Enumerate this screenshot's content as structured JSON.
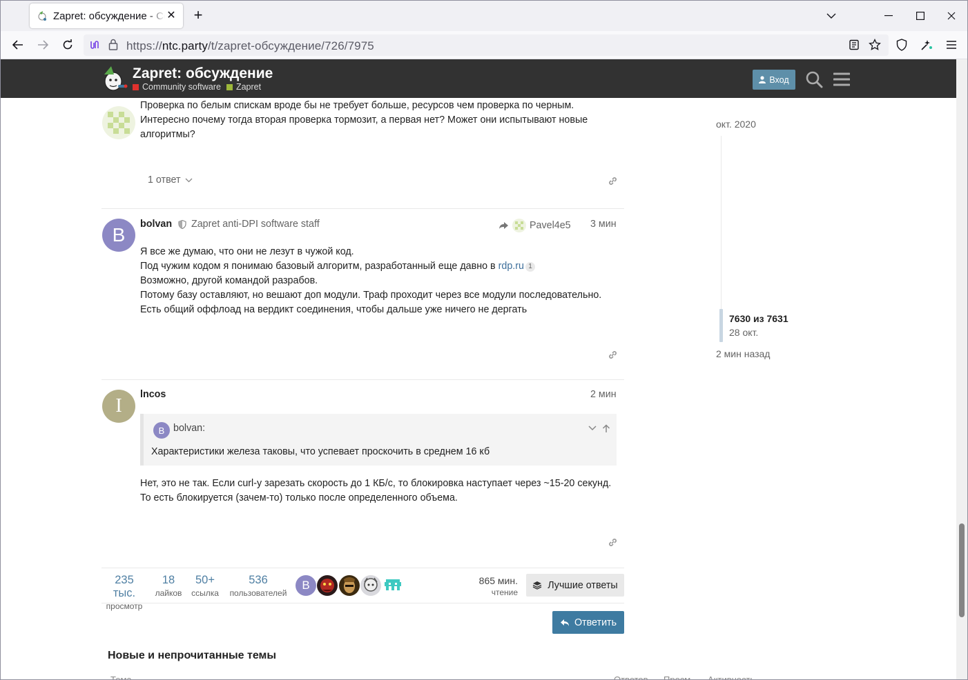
{
  "browser": {
    "tab_title": "Zapret: обсуждение - Community software",
    "url_scheme": "https://",
    "url_host": "ntc.party",
    "url_path": "/t/zapret-обсуждение/726/7975"
  },
  "site": {
    "title": "Zapret: обсуждение",
    "categories": [
      {
        "label": "Community software",
        "color": "#e0312d"
      },
      {
        "label": "Zapret",
        "color": "#9eb83b"
      }
    ],
    "login_label": "Вход"
  },
  "posts": [
    {
      "lines": [
        "Проверка по белым спискам вроде бы не требует больше, ресурсов чем проверка по черным.",
        "Интересно почему тогда вторая проверка тормозит, а первая нет? Может они испытывают новые",
        "алгоритмы?"
      ],
      "replies_label": "1 ответ"
    },
    {
      "username": "bolvan",
      "avatar_letter": "B",
      "avatar_color": "#8c88c4",
      "user_title": "Zapret anti-DPI software staff",
      "reply_to": "Pavel4e5",
      "time": "3 мин",
      "lines": [
        "Я все же думаю, что они не лезут в чужой код.",
        "Под чужим кодом я понимаю базовый алгоритм, разработанный еще давно в",
        "Возможно, другой командой разрабов.",
        "Потому базу оставляют, но вешают доп модули. Траф проходит через все модули последовательно.",
        "Есть общий оффлоад на вердикт соединения, чтобы дальше уже ничего не дергать"
      ],
      "link_text": "rdp.ru",
      "link_count": "1"
    },
    {
      "username": "lncos",
      "avatar_letter": "I",
      "avatar_color": "#b3ae87",
      "time": "2 мин",
      "quote": {
        "author": "bolvan:",
        "author_letter": "B",
        "text": "Характеристики железа таковы, что успевает проскочить в среднем 16 кб"
      },
      "lines": [
        "Нет, это не так. Если curl-у зарезать скорость до 1 КБ/с, то блокировка наступает через ~15-20 секунд.",
        "То есть блокируется (зачем-то) только после определенного объема."
      ]
    }
  ],
  "topic_map": {
    "views": {
      "value": "235 тыс.",
      "label": "просмотр"
    },
    "likes": {
      "value": "18",
      "label": "лайков"
    },
    "links": {
      "value": "50+",
      "label": "ссылка"
    },
    "users": {
      "value": "536",
      "label": "пользователей"
    },
    "participant_avatar_letter": "B",
    "read_time": {
      "value": "865 мин.",
      "label": "чтение"
    },
    "summary_label": "Лучшие ответы"
  },
  "reply_label": "Ответить",
  "suggested": {
    "heading": "Новые и непрочитанные темы",
    "columns": [
      "Тема",
      "Ответов",
      "Просм.",
      "Активность"
    ]
  },
  "timeline": {
    "start_date": "окт. 2020",
    "position": "7630 из 7631",
    "position_date": "28 окт.",
    "end_label": "2 мин назад"
  }
}
